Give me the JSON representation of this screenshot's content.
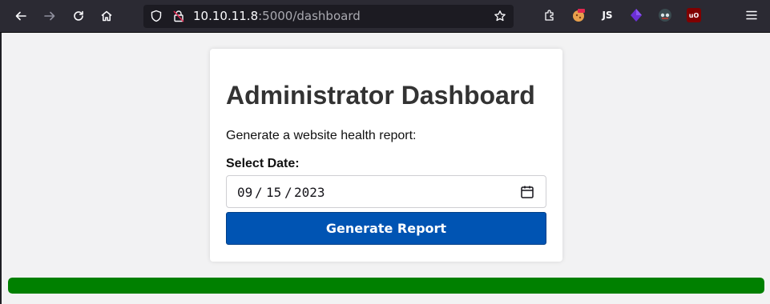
{
  "browser": {
    "url_host": "10.10.11.8",
    "url_path": ":5000/dashboard",
    "nav": [
      "back-icon",
      "forward-icon",
      "reload-icon",
      "home-icon"
    ],
    "extensions": [
      {
        "name": "extensions-icon",
        "label": ""
      },
      {
        "name": "cookie-extension-icon",
        "label": ""
      },
      {
        "name": "javascript-extension-icon",
        "label": "JS"
      },
      {
        "name": "cube-extension-icon",
        "label": ""
      },
      {
        "name": "spy-extension-icon",
        "label": ""
      },
      {
        "name": "ublock-origin-icon",
        "label": "uO"
      },
      {
        "name": "menu-icon",
        "label": ""
      }
    ]
  },
  "dashboard": {
    "title": "Administrator Dashboard",
    "subtitle": "Generate a website health report:",
    "date_label": "Select Date:",
    "date": {
      "month": "09",
      "day": "15",
      "year": "2023",
      "separator": "/"
    },
    "button_label": "Generate Report"
  },
  "progress": {
    "percent": 100,
    "color": "#008000"
  },
  "colors": {
    "button": "#0054b3",
    "toolbar": "#2b2a33",
    "background": "#f2f2f3"
  }
}
